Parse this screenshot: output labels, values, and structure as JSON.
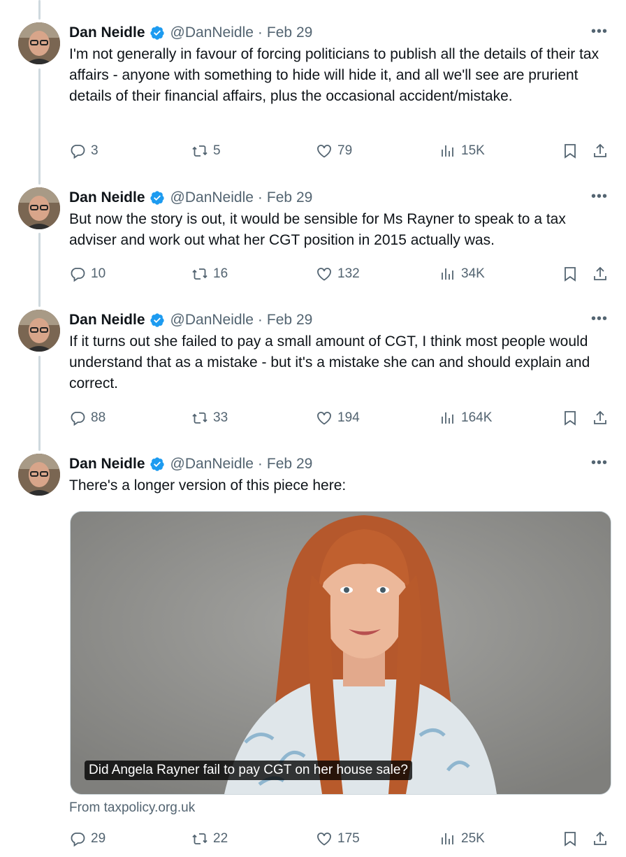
{
  "tweets": [
    {
      "author": "Dan Neidle",
      "handle": "@DanNeidle",
      "date": "Feb 29",
      "text": "I'm not generally in favour of forcing politicians to publish all the details of their tax affairs - anyone with something to hide will hide it, and all we'll see are prurient details of their financial affairs, plus the occasional accident/mistake.",
      "replies": "3",
      "reposts": "5",
      "likes": "79",
      "views": "15K"
    },
    {
      "author": "Dan Neidle",
      "handle": "@DanNeidle",
      "date": "Feb 29",
      "text": "But now the story is out, it would be sensible for Ms Rayner to speak to a tax adviser and work out what her CGT position in 2015 actually was.",
      "replies": "10",
      "reposts": "16",
      "likes": "132",
      "views": "34K"
    },
    {
      "author": "Dan Neidle",
      "handle": "@DanNeidle",
      "date": "Feb 29",
      "text": "If it turns out she failed to pay a small amount of CGT, I think most people would understand that as a mistake - but it's a mistake she can and should explain and correct.",
      "replies": "88",
      "reposts": "33",
      "likes": "194",
      "views": "164K"
    },
    {
      "author": "Dan Neidle",
      "handle": "@DanNeidle",
      "date": "Feb 29",
      "text": "There's a longer version of this piece here:",
      "replies": "29",
      "reposts": "22",
      "likes": "175",
      "views": "25K"
    }
  ],
  "link_card": {
    "caption": "Did Angela Rayner fail to pay CGT on her house sale?",
    "source": "From taxpolicy.org.uk"
  },
  "ui": {
    "separator": "·",
    "more": "•••"
  },
  "colors": {
    "verified": "#1d9bf0",
    "muted": "#536471",
    "text": "#0f1419",
    "thread_line": "#cfd9de"
  }
}
